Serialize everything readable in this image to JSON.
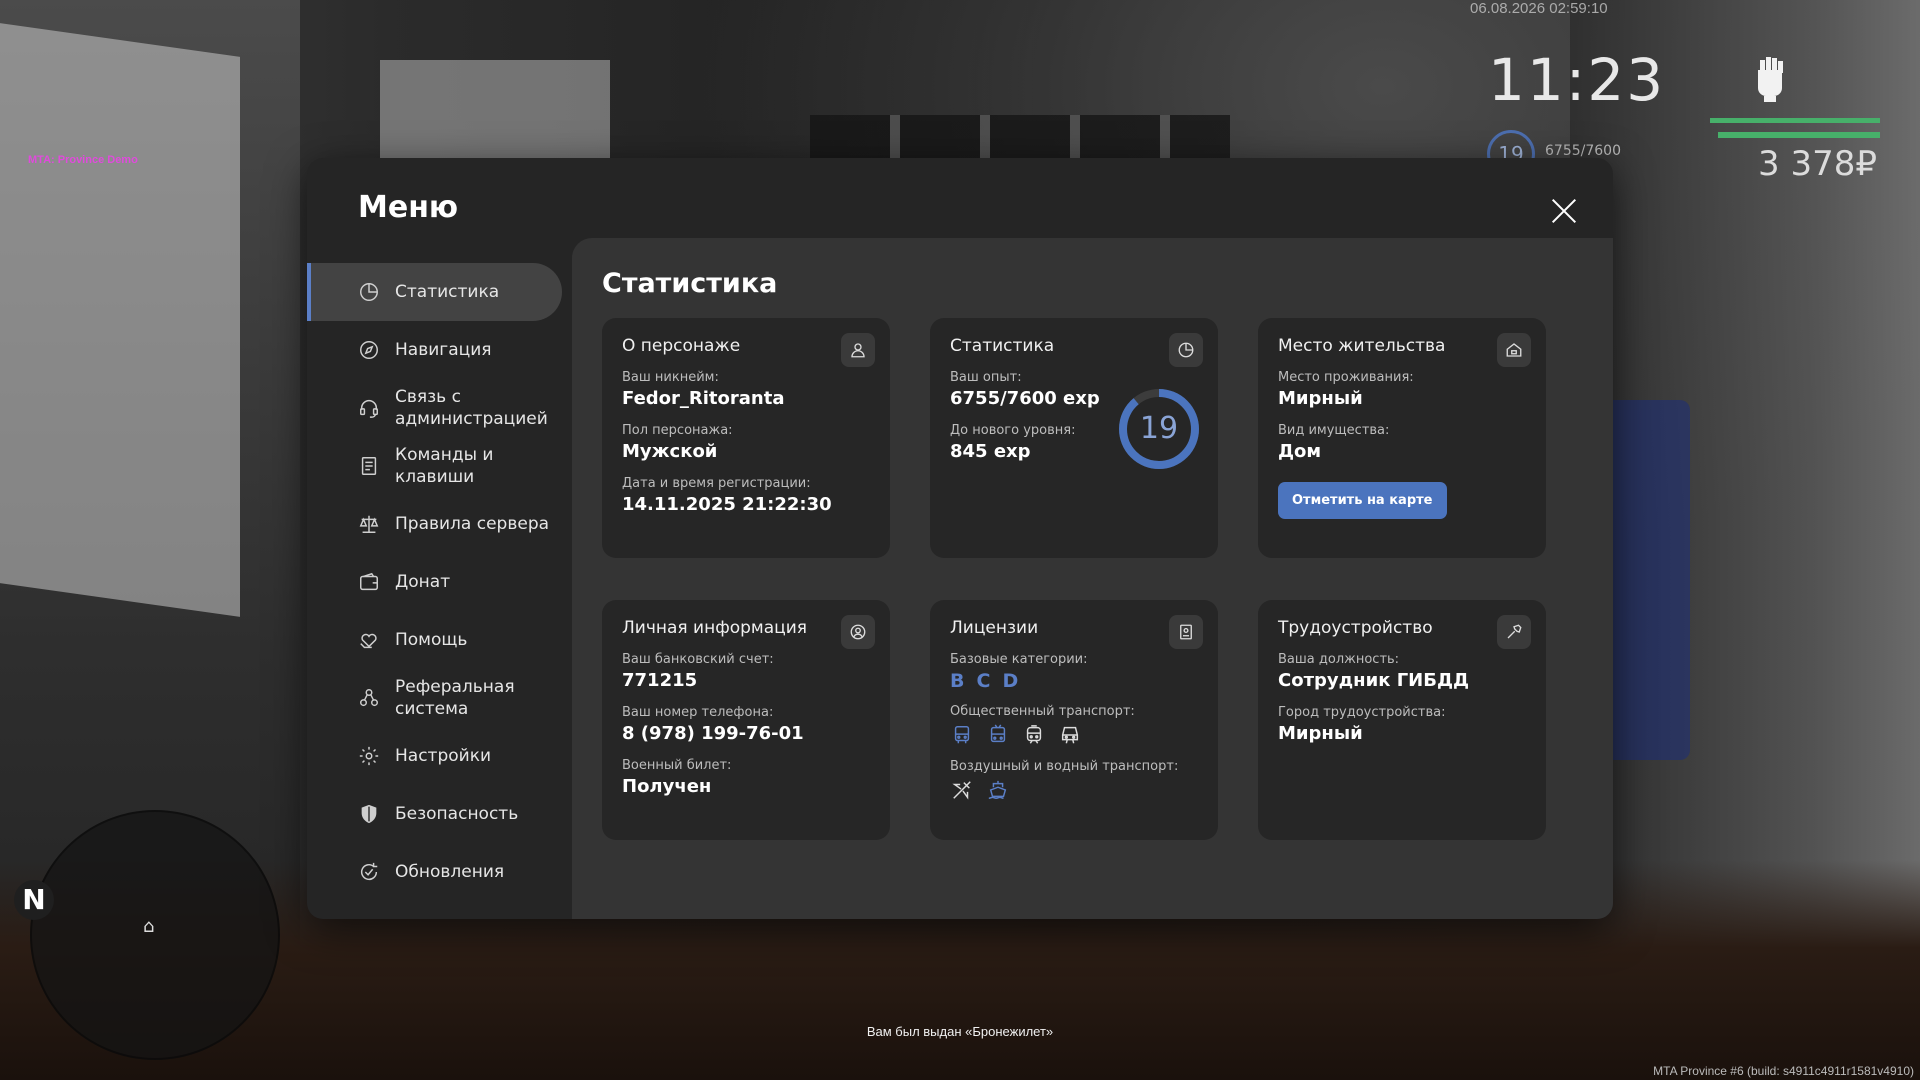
{
  "hud": {
    "server_tag": "MTA: Province Demo",
    "datetime": "06.08.2026 02:59:10",
    "clock": "11:23",
    "level": "19",
    "exp": "6755/7600",
    "money": "3 378₽",
    "compass_letter": "N",
    "notification": "Вам был выдан «Бронежилет»",
    "build": "MTA Province #6 (build: s4911c4911r1581v4910)",
    "health_color": "#47b06a"
  },
  "menu": {
    "title": "Меню",
    "accent": "#5b7fc7",
    "sidebar": [
      {
        "label": "Статистика",
        "icon": "pie-chart-icon"
      },
      {
        "label": "Навигация",
        "icon": "compass-icon"
      },
      {
        "label": "Связь с\nадминистрацией",
        "icon": "headset-icon"
      },
      {
        "label": "Команды и\nклавиши",
        "icon": "document-icon"
      },
      {
        "label": "Правила сервера",
        "icon": "scales-icon"
      },
      {
        "label": "Донат",
        "icon": "wallet-icon"
      },
      {
        "label": "Помощь",
        "icon": "heart-hand-icon"
      },
      {
        "label": "Реферальная\nсистема",
        "icon": "referral-icon"
      },
      {
        "label": "Настройки",
        "icon": "gear-icon"
      },
      {
        "label": "Безопасность",
        "icon": "shield-icon"
      },
      {
        "label": "Обновления",
        "icon": "update-icon"
      }
    ]
  },
  "stats": {
    "title": "Статистика",
    "character": {
      "title": "О персонаже",
      "nick_label": "Ваш никнейм:",
      "nick": "Fedor_Ritoranta",
      "gender_label": "Пол персонажа:",
      "gender": "Мужской",
      "reg_label": "Дата и время регистрации:",
      "reg": "14.11.2025 21:22:30"
    },
    "statistics": {
      "title": "Статистика",
      "exp_label": "Ваш опыт:",
      "exp": "6755/7600 exp",
      "next_label": "До нового уровня:",
      "next": "845 exp",
      "level": "19",
      "progress": 0.889
    },
    "residence": {
      "title": "Место жительства",
      "place_label": "Место проживания:",
      "place": "Мирный",
      "property_label": "Вид имущества:",
      "property": "Дом",
      "button": "Отметить на карте"
    },
    "personal": {
      "title": "Личная информация",
      "bank_label": "Ваш банковский счет:",
      "bank": "771215",
      "phone_label": "Ваш номер телефона:",
      "phone": "8 (978) 199-76-01",
      "military_label": "Военный билет:",
      "military": "Получен"
    },
    "licenses": {
      "title": "Лицензии",
      "base_label": "Базовые категории:",
      "categories": [
        "B",
        "C",
        "D"
      ],
      "public_label": "Общественный транспорт:",
      "public_icons": [
        "bus-icon",
        "trolleybus-icon",
        "tram-icon",
        "train-icon"
      ],
      "air_label": "Воздушный и водный транспорт:",
      "air_icons": [
        "plane-icon",
        "boat-icon"
      ]
    },
    "employment": {
      "title": "Трудоустройство",
      "position_label": "Ваша должность:",
      "position": "Сотрудник ГИБДД",
      "city_label": "Город трудоустройства:",
      "city": "Мирный"
    }
  }
}
